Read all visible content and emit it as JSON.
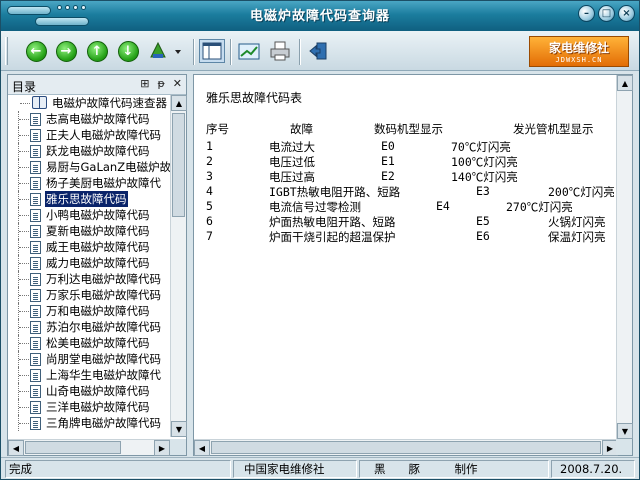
{
  "window": {
    "title": "电磁炉故障代码查询器"
  },
  "toolbar": {
    "back_glyph": "←",
    "forward_glyph": "→",
    "up_glyph": "↑",
    "down_glyph": "↓",
    "logo_main": "家电维修社",
    "logo_sub": "JDWXSH.CN"
  },
  "left_panel": {
    "title": "目录",
    "pin_glyph": "⊞",
    "dock_glyph": "ᵽ",
    "close_glyph": "✕",
    "root_label": "电磁炉故障代码速查器",
    "items": [
      "志高电磁炉故障代码",
      "正夫人电磁炉故障代码",
      "跃龙电磁炉故障代码",
      "易厨与GaLanZ电磁炉故",
      "杨子美厨电磁炉故障代",
      "雅乐思故障代码",
      "小鸭电磁炉故障代码",
      "夏新电磁炉故障代码",
      "威王电磁炉故障代码",
      "威力电磁炉故障代码",
      "万利达电磁炉故障代码",
      "万家乐电磁炉故障代码",
      "万和电磁炉故障代码",
      "苏泊尔电磁炉故障代码",
      "松美电磁炉故障代码",
      "尚朋堂电磁炉故障代码",
      "上海华生电磁炉故障代",
      "山奇电磁炉故障代码",
      "三洋电磁炉故障代码",
      "三角牌电磁炉故障代码"
    ],
    "selected_index": 5
  },
  "document": {
    "title": "雅乐思故障代码表",
    "header": [
      "序号",
      "故障",
      "数码机型显示",
      "发光管机型显示"
    ],
    "rows": [
      [
        "1",
        "电流过大",
        "E0",
        "70℃灯闪亮"
      ],
      [
        "2",
        "电压过低",
        "E1",
        "100℃灯闪亮"
      ],
      [
        "3",
        "电压过高",
        "E2",
        "140℃灯闪亮"
      ],
      [
        "4",
        "IGBT热敏电阻开路、短路",
        "E3",
        "200℃灯闪亮"
      ],
      [
        "5",
        "电流信号过零检测",
        "E4",
        "270℃灯闪亮"
      ],
      [
        "6",
        "炉面热敏电阻开路、短路",
        "E5",
        "火锅灯闪亮"
      ],
      [
        "7",
        "炉面干烧引起的超温保护",
        "E6",
        "保温灯闪亮"
      ]
    ]
  },
  "statusbar": {
    "status": "完成",
    "org": "中国家电维修社",
    "author": "黑　　豚　　　制作",
    "date": "2008.7.20."
  }
}
